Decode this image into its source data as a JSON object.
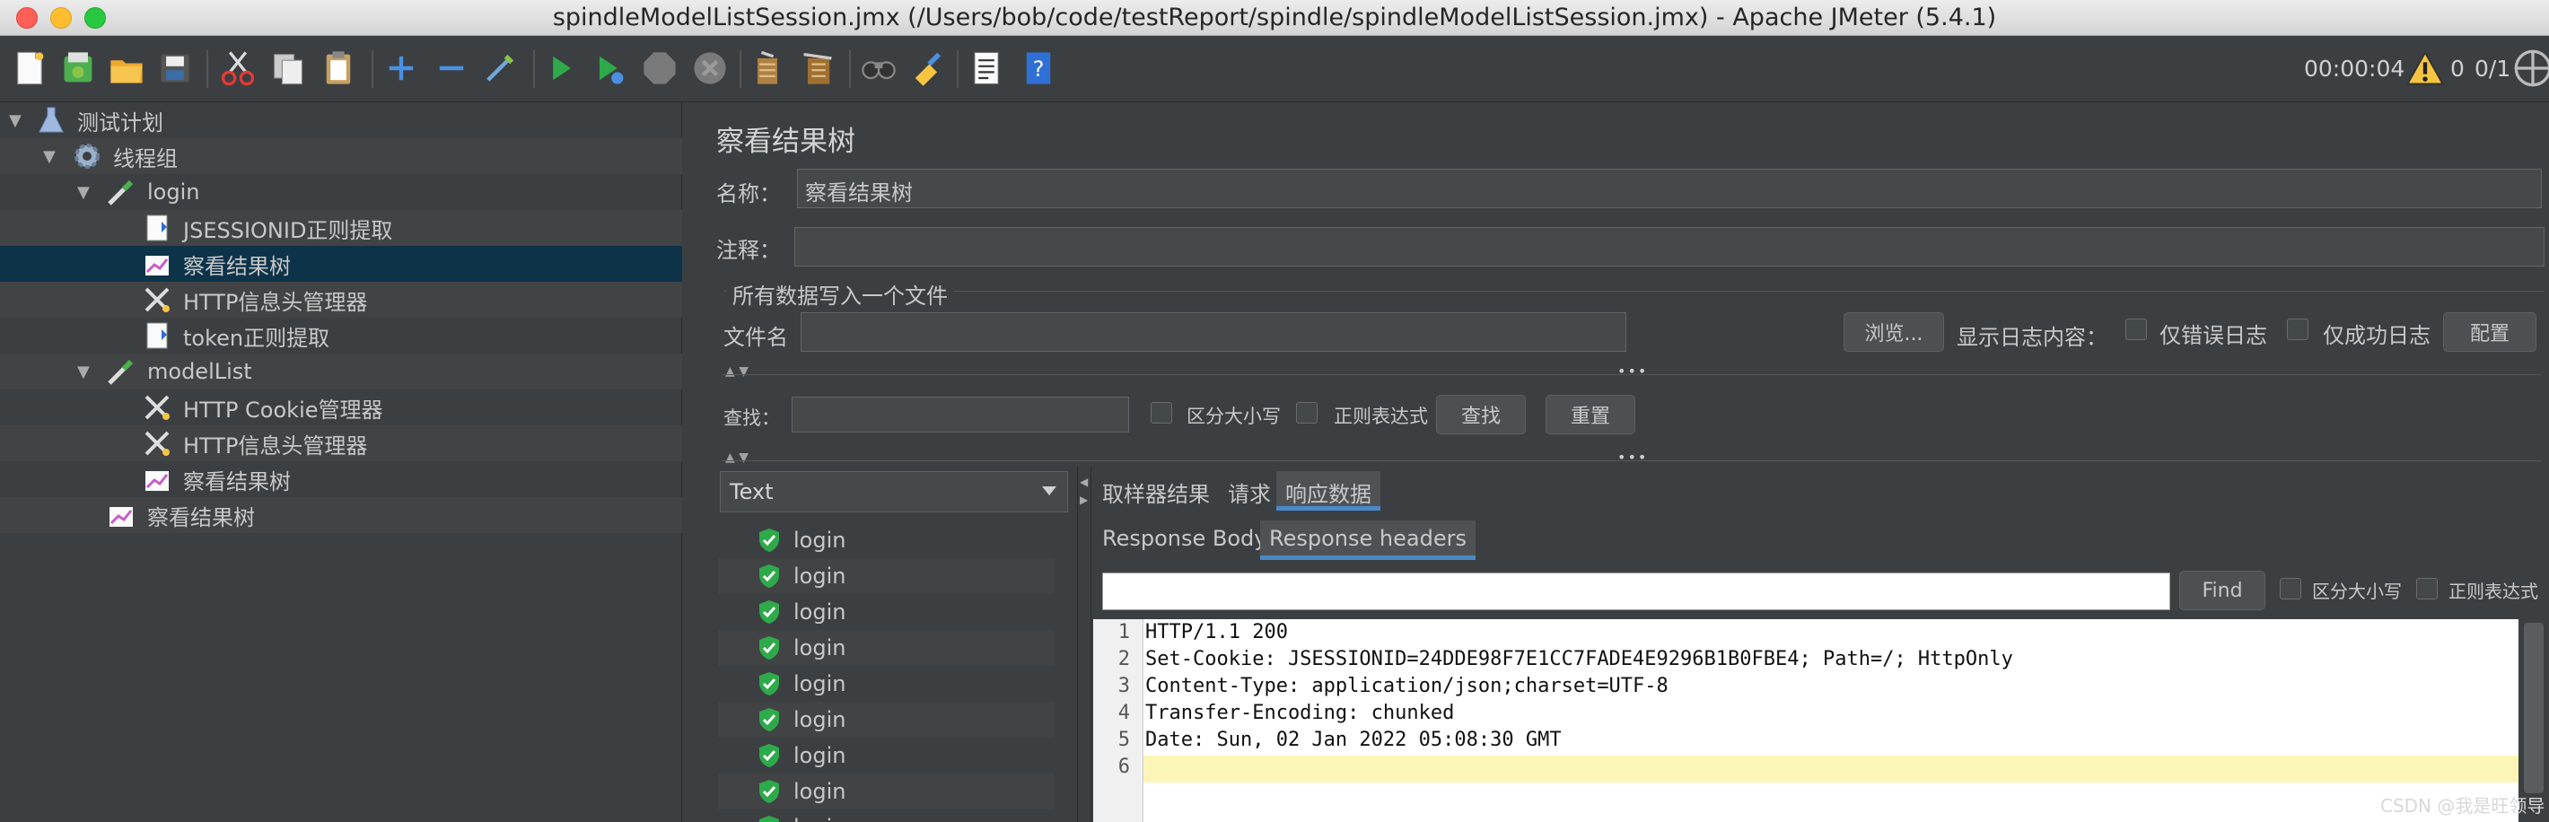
{
  "window": {
    "title": "spindleModelListSession.jmx (/Users/bob/code/testReport/spindle/spindleModelListSession.jmx) - Apache JMeter (5.4.1)"
  },
  "toolbar": {
    "icons": [
      "new-icon",
      "templates-icon",
      "open-icon",
      "save-icon",
      "cut-icon",
      "copy-icon",
      "paste-icon",
      "expand-icon",
      "collapse-icon",
      "toggle-icon",
      "start-icon",
      "start-no-pause-icon",
      "stop-icon",
      "shutdown-icon",
      "clear-icon",
      "clear-all-icon",
      "search-icon",
      "reset-search-icon",
      "function-helper-icon",
      "help-icon"
    ],
    "elapsed": "00:00:04",
    "warnings": "0",
    "threads": "0/1"
  },
  "tree": {
    "nodes": [
      {
        "label": "测试计划"
      },
      {
        "label": "线程组"
      },
      {
        "label": "login"
      },
      {
        "label": "JSESSIONID正则提取"
      },
      {
        "label": "察看结果树"
      },
      {
        "label": "HTTP信息头管理器"
      },
      {
        "label": "token正则提取"
      },
      {
        "label": "modelList"
      },
      {
        "label": "HTTP Cookie管理器"
      },
      {
        "label": "HTTP信息头管理器"
      },
      {
        "label": "察看结果树"
      },
      {
        "label": "察看结果树"
      }
    ]
  },
  "panel": {
    "title": "察看结果树",
    "name_label": "名称：",
    "name_value": "察看结果树",
    "comment_label": "注释：",
    "comment_value": "",
    "file_section": "所有数据写入一个文件",
    "filename_label": "文件名",
    "filename_value": "",
    "browse_button": "浏览...",
    "log_label": "显示日志内容：",
    "errors_only": "仅错误日志",
    "success_only": "仅成功日志",
    "config_button": "配置",
    "search_label": "查找：",
    "search_value": "",
    "case_sensitive": "区分大小写",
    "regex": "正则表达式",
    "find_button": "查找",
    "reset_button": "重置"
  },
  "results": {
    "renderer": "Text",
    "items": [
      "login",
      "login",
      "login",
      "login",
      "login",
      "login",
      "login",
      "login",
      "login"
    ],
    "tabs": [
      "取样器结果",
      "请求",
      "响应数据"
    ],
    "active_tab": "响应数据",
    "subtabs": [
      "Response Body",
      "Response headers"
    ],
    "active_subtab": "Response headers",
    "find_value": "",
    "find_button": "Find",
    "case_sensitive": "区分大小写",
    "regex": "正则表达式"
  },
  "editor": {
    "line_numbers": [
      "1",
      "2",
      "3",
      "4",
      "5",
      "6"
    ],
    "lines": [
      "HTTP/1.1 200",
      "Set-Cookie: JSESSIONID=24DDE98F7E1CC7FADE4E9296B1B0FBE4; Path=/; HttpOnly",
      "Content-Type: application/json;charset=UTF-8",
      "Transfer-Encoding: chunked",
      "Date: Sun, 02 Jan 2022 05:08:30 GMT",
      ""
    ]
  },
  "watermark": "CSDN @我是旺领导"
}
